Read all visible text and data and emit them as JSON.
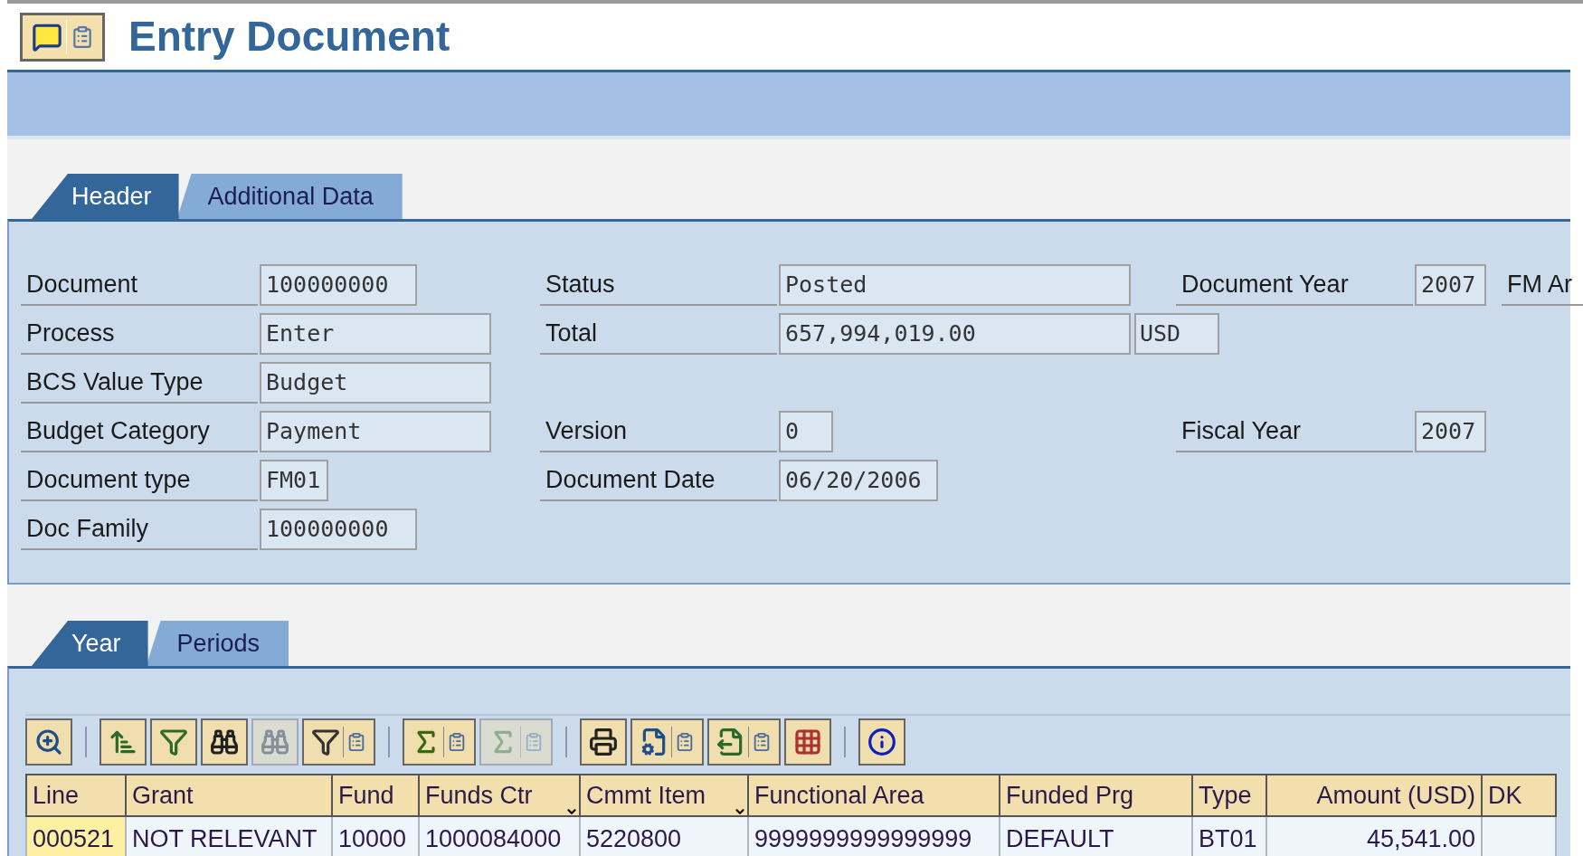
{
  "title": "Entry Document",
  "header_tabs": [
    {
      "label": "Header",
      "selected": true
    },
    {
      "label": "Additional Data",
      "selected": false
    }
  ],
  "form_rows": [
    {
      "fields": [
        {
          "kind": "left",
          "label": "Document",
          "value": "100000000"
        },
        {
          "kind": "middle",
          "label": "Status",
          "value": "Posted"
        },
        {
          "kind": "right",
          "label": "Document Year",
          "value": "2007"
        },
        {
          "kind": "far",
          "label": "FM Ar"
        }
      ]
    },
    {
      "fields": [
        {
          "kind": "left",
          "label": "Process",
          "value": "Enter"
        },
        {
          "kind": "middle",
          "label": "Total",
          "value": "657,994,019.00",
          "unit": "USD"
        }
      ]
    },
    {
      "fields": [
        {
          "kind": "left",
          "label": "BCS Value Type",
          "value": "Budget"
        }
      ]
    },
    {
      "fields": [
        {
          "kind": "left",
          "label": "Budget Category",
          "value": "Payment"
        },
        {
          "kind": "middle",
          "label": "Version",
          "value": "0"
        },
        {
          "kind": "right",
          "label": "Fiscal Year",
          "value": "2007"
        }
      ]
    },
    {
      "fields": [
        {
          "kind": "left",
          "label": "Document type",
          "value": "FM01"
        },
        {
          "kind": "middle",
          "label": "Document Date",
          "value": "06/20/2006"
        }
      ]
    },
    {
      "fields": [
        {
          "kind": "left",
          "label": "Doc Family",
          "value": "100000000"
        }
      ]
    }
  ],
  "detail_tabs": [
    {
      "label": "Year",
      "selected": true
    },
    {
      "label": "Periods",
      "selected": false
    }
  ],
  "toolbar": [
    {
      "buttons": [
        {
          "disabled": false,
          "menu": false
        }
      ]
    },
    {
      "buttons": [
        {
          "disabled": false,
          "menu": false
        },
        {
          "disabled": false,
          "menu": false
        },
        {
          "disabled": false,
          "menu": false
        },
        {
          "disabled": true,
          "menu": false
        },
        {
          "disabled": false,
          "menu": true
        }
      ]
    },
    {
      "buttons": [
        {
          "disabled": false,
          "menu": true
        },
        {
          "disabled": true,
          "menu": true
        }
      ]
    },
    {
      "buttons": [
        {
          "disabled": false,
          "menu": false
        },
        {
          "disabled": false,
          "menu": true
        },
        {
          "disabled": false,
          "menu": true
        },
        {
          "disabled": false,
          "menu": false
        }
      ]
    },
    {
      "buttons": [
        {
          "disabled": false,
          "menu": false
        }
      ]
    }
  ],
  "table": {
    "columns": [
      {
        "label": "Line",
        "sorted": false,
        "kind": "text"
      },
      {
        "label": "Grant",
        "sorted": false,
        "kind": "text"
      },
      {
        "label": "Fund",
        "sorted": false,
        "kind": "text"
      },
      {
        "label": "Funds Ctr",
        "sorted": true,
        "kind": "text"
      },
      {
        "label": "Cmmt Item",
        "sorted": true,
        "kind": "text"
      },
      {
        "label": "Functional Area",
        "sorted": false,
        "kind": "text"
      },
      {
        "label": "Funded Prg",
        "sorted": false,
        "kind": "text"
      },
      {
        "label": "Type",
        "sorted": false,
        "kind": "text"
      },
      {
        "label": "Amount (USD)",
        "sorted": false,
        "kind": "amount"
      },
      {
        "label": "DK",
        "sorted": false,
        "kind": "text"
      }
    ],
    "rows": [
      {
        "cells": [
          {
            "text": "000521",
            "selected": true
          },
          {
            "text": "NOT RELEVANT",
            "selected": false
          },
          {
            "text": "10000",
            "selected": false
          },
          {
            "text": "1000084000",
            "selected": false
          },
          {
            "text": "5220800",
            "selected": false
          },
          {
            "text": "9999999999999999",
            "selected": false
          },
          {
            "text": "DEFAULT",
            "selected": false
          },
          {
            "text": "BT01",
            "selected": false
          },
          {
            "text": "45,541.00",
            "selected": false
          },
          {
            "text": "",
            "selected": false
          }
        ]
      }
    ]
  }
}
